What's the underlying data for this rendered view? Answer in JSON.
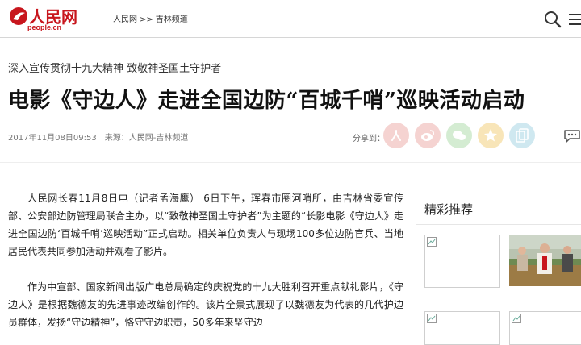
{
  "header": {
    "logo_name": "人民网",
    "logo_domain": "people.cn",
    "breadcrumb": [
      "人民网",
      "吉林频道"
    ],
    "breadcrumb_sep": ">>"
  },
  "article": {
    "kicker": "深入宣传贯彻十九大精神  致敬神圣国土守护者",
    "title": "电影《守边人》走进全国边防“百城千哨”巡映活动启动",
    "date": "2017年11月08日09:53",
    "source": "来源：人民网-吉林频道",
    "share_label": "分享到：",
    "share_icons": [
      "people-share-icon",
      "weibo-share-icon",
      "wechat-share-icon",
      "qzone-share-icon",
      "copy-link-icon"
    ],
    "paragraphs": [
      "人民网长春11月8日电（记者孟海鹰） 6日下午，珲春市圈河哨所，由吉林省委宣传部、公安部边防管理局联合主办，以“致敬神圣国土守护者”为主题的“长影电影《守边人》走进全国边防‘百城千哨’巡映活动”正式启动。相关单位负责人与现场100多位边防官兵、当地居民代表共同参加活动并观看了影片。",
      "作为中宣部、国家新闻出版广电总局确定的庆祝党的十九大胜利召开重点献礼影片，《守边人》是根据魏德友的先进事迹改编创作的。该片全景式展现了以魏德友为代表的几代护边员群体，发扬“守边精神”，恪守守边职责，50多年来坚守边"
    ]
  },
  "sidebar": {
    "title": "精彩推荐"
  },
  "colors": {
    "brand_red": "#c8161d",
    "share_people": "#e9a6a2",
    "share_wechat": "#8ac987",
    "share_qzone": "#efc46a",
    "share_copy": "#86c3d8"
  }
}
